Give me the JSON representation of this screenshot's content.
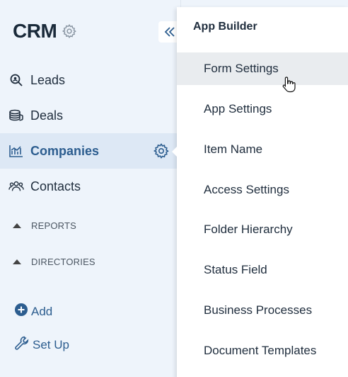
{
  "sidebar": {
    "app_title": "CRM",
    "nav": [
      {
        "label": "Leads",
        "icon": "search-icon"
      },
      {
        "label": "Deals",
        "icon": "coins-icon"
      },
      {
        "label": "Companies",
        "icon": "chart-icon",
        "active": true
      },
      {
        "label": "Contacts",
        "icon": "people-icon"
      }
    ],
    "groups": [
      {
        "label": "REPORTS"
      },
      {
        "label": "DIRECTORIES"
      }
    ],
    "actions": [
      {
        "label": "Add",
        "icon": "plus-circle-icon"
      },
      {
        "label": "Set Up",
        "icon": "wrench-icon"
      }
    ]
  },
  "menu": {
    "header": "App Builder",
    "items": [
      {
        "label": "Form Settings",
        "hover": true
      },
      {
        "label": "App Settings"
      },
      {
        "label": "Item Name"
      },
      {
        "label": "Access Settings"
      },
      {
        "label": "Folder Hierarchy"
      },
      {
        "label": "Status Field"
      },
      {
        "label": "Business Processes"
      },
      {
        "label": "Document Templates"
      }
    ]
  },
  "colors": {
    "sidebar_bg": "#eef4fb",
    "active_bg": "#dde8f5",
    "accent": "#2c5d8f",
    "hover_bg": "#e9ecef"
  }
}
